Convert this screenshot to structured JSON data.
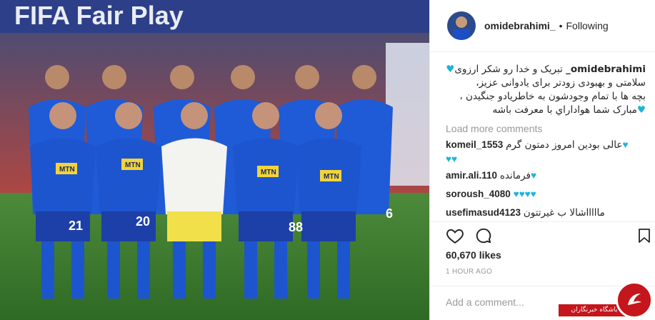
{
  "photo": {
    "banner": "FIFA Fair Play",
    "jersey_sponsor": "MTN",
    "jersey_numbers": [
      "21",
      "20",
      "88",
      "6"
    ]
  },
  "header": {
    "username": "omidebrahimi_",
    "separator": "•",
    "follow_status": "Following"
  },
  "caption": {
    "username": "omidebrahimi_",
    "lines": [
      "تبریک و خدا رو شکر ارزوی",
      "سلامتی و بهبودی زودتر برای یادوانی عزیز،",
      "بچه ها با تمام وجودشون به خاطریادو جنگیدن ،",
      "مبارک شما هواداراي با معرفت باشه"
    ]
  },
  "load_more": "Load more comments",
  "comments": [
    {
      "user": "komeil_1553",
      "text": "عالی بودین امروز دمتون گرم"
    },
    {
      "user": "amir.ali.110",
      "text": "فرمانده"
    },
    {
      "user": "soroush_4080",
      "text": ""
    },
    {
      "user": "usefimasud4123",
      "text": "ماااااشالا ب غیرتتون"
    }
  ],
  "likes": "60,670 likes",
  "time_ago": "1 HOUR AGO",
  "add_comment_placeholder": "Add a comment...",
  "watermark": "باشگاه خبرنگاران",
  "colors": {
    "heart": "#1cb4d8",
    "muted": "#999999",
    "text": "#262626",
    "watermark": "#c4161c"
  },
  "icons": [
    "heart-icon",
    "comment-icon",
    "bookmark-icon"
  ]
}
